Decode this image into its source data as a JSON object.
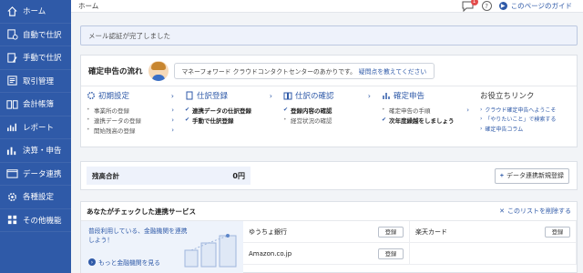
{
  "sidebar": {
    "items": [
      {
        "label": "ホーム",
        "icon": "home-icon"
      },
      {
        "label": "自動で仕訳",
        "icon": "auto-journal-icon"
      },
      {
        "label": "手動で仕訳",
        "icon": "manual-journal-icon"
      },
      {
        "label": "取引管理",
        "icon": "transaction-icon"
      },
      {
        "label": "会計帳簿",
        "icon": "ledger-icon"
      },
      {
        "label": "レポート",
        "icon": "report-icon"
      },
      {
        "label": "決算・申告",
        "icon": "tax-return-icon"
      },
      {
        "label": "データ連携",
        "icon": "data-link-icon"
      },
      {
        "label": "各種設定",
        "icon": "gear-icon"
      },
      {
        "label": "その他機能",
        "icon": "grid-icon"
      }
    ]
  },
  "topbar": {
    "breadcrumb": "ホーム",
    "notification_count": "1",
    "help": "?",
    "guide_label": "このページのガイド"
  },
  "notice": {
    "text": "メール認証が完了しました"
  },
  "flow": {
    "title": "確定申告の流れ",
    "bubble_text": "マネーフォワード クラウドコンタクトセンターのあかりです。",
    "bubble_link": "疑問点を教えてください",
    "steps": [
      {
        "title": "初期設定",
        "items": [
          {
            "label": "事業所の登録",
            "done": false
          },
          {
            "label": "連携データの登録",
            "done": false
          },
          {
            "label": "開始残高の登録",
            "done": false
          }
        ]
      },
      {
        "title": "仕訳登録",
        "items": [
          {
            "label": "連携データの仕訳登録",
            "done": true
          },
          {
            "label": "手動で仕訳登録",
            "done": true
          }
        ]
      },
      {
        "title": "仕訳の確認",
        "items": [
          {
            "label": "登録内容の確認",
            "done": true
          },
          {
            "label": "経営状況の確認",
            "done": false
          }
        ]
      },
      {
        "title": "確定申告",
        "items": [
          {
            "label": "確定申告の手順",
            "done": false
          },
          {
            "label": "次年度繰越をしましょう",
            "done": true
          }
        ]
      }
    ],
    "links": {
      "title": "お役立ちリンク",
      "items": [
        "クラウド確定申告へようこそ",
        "「やりたいこと」で検索する",
        "確定申告コラム"
      ]
    }
  },
  "balance": {
    "label": "残高合計",
    "value": "0円",
    "add_button": "データ連携新規登録"
  },
  "services": {
    "title": "あなたがチェックした連携サービス",
    "delete_label": "このリストを削除する",
    "promo_text": "普段利用している、金融機関を連携しよう！",
    "promo_more": "もっと金融機関を見る",
    "register_label": "登録",
    "items": [
      "ゆうちょ銀行",
      "楽天カード",
      "Amazon.co.jp"
    ]
  },
  "colors": {
    "sidebar": "#2f5aa8",
    "accent": "#2f5aa8",
    "badge": "#e34c4c"
  }
}
